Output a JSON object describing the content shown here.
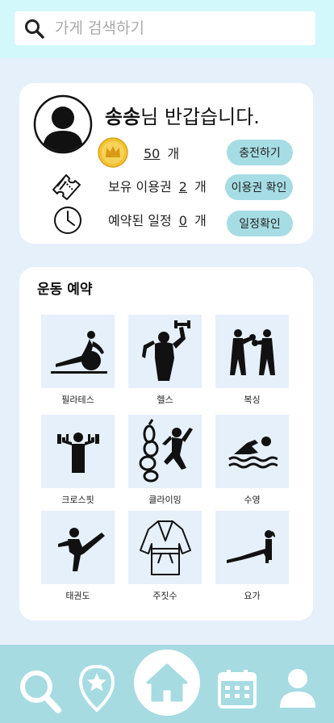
{
  "search": {
    "placeholder": "가게 검색하기"
  },
  "profile": {
    "name": "송송",
    "greeting_suffix": "님 반갑습니다.",
    "coins": {
      "value": "50",
      "unit": "개"
    },
    "tickets": {
      "label": "보유 이용권",
      "value": "2",
      "unit": "개"
    },
    "schedule": {
      "label": "예약된 일정",
      "value": "0",
      "unit": "개"
    },
    "buttons": {
      "charge": "충전하기",
      "ticket_check": "이용권 확인",
      "schedule_check": "일정확인"
    }
  },
  "exercise": {
    "title": "운동 예약",
    "items": [
      {
        "label": "필라테스",
        "icon": "pilates-icon"
      },
      {
        "label": "헬스",
        "icon": "fitness-icon"
      },
      {
        "label": "복싱",
        "icon": "boxing-icon"
      },
      {
        "label": "크로스핏",
        "icon": "crossfit-icon"
      },
      {
        "label": "클라이밍",
        "icon": "climbing-icon"
      },
      {
        "label": "수영",
        "icon": "swimming-icon"
      },
      {
        "label": "태권도",
        "icon": "taekwondo-icon"
      },
      {
        "label": "주짓수",
        "icon": "jiujitsu-icon"
      },
      {
        "label": "요가",
        "icon": "yoga-icon"
      }
    ]
  },
  "nav": [
    "search-icon",
    "location-star-icon",
    "home-icon",
    "calendar-icon",
    "user-icon"
  ]
}
